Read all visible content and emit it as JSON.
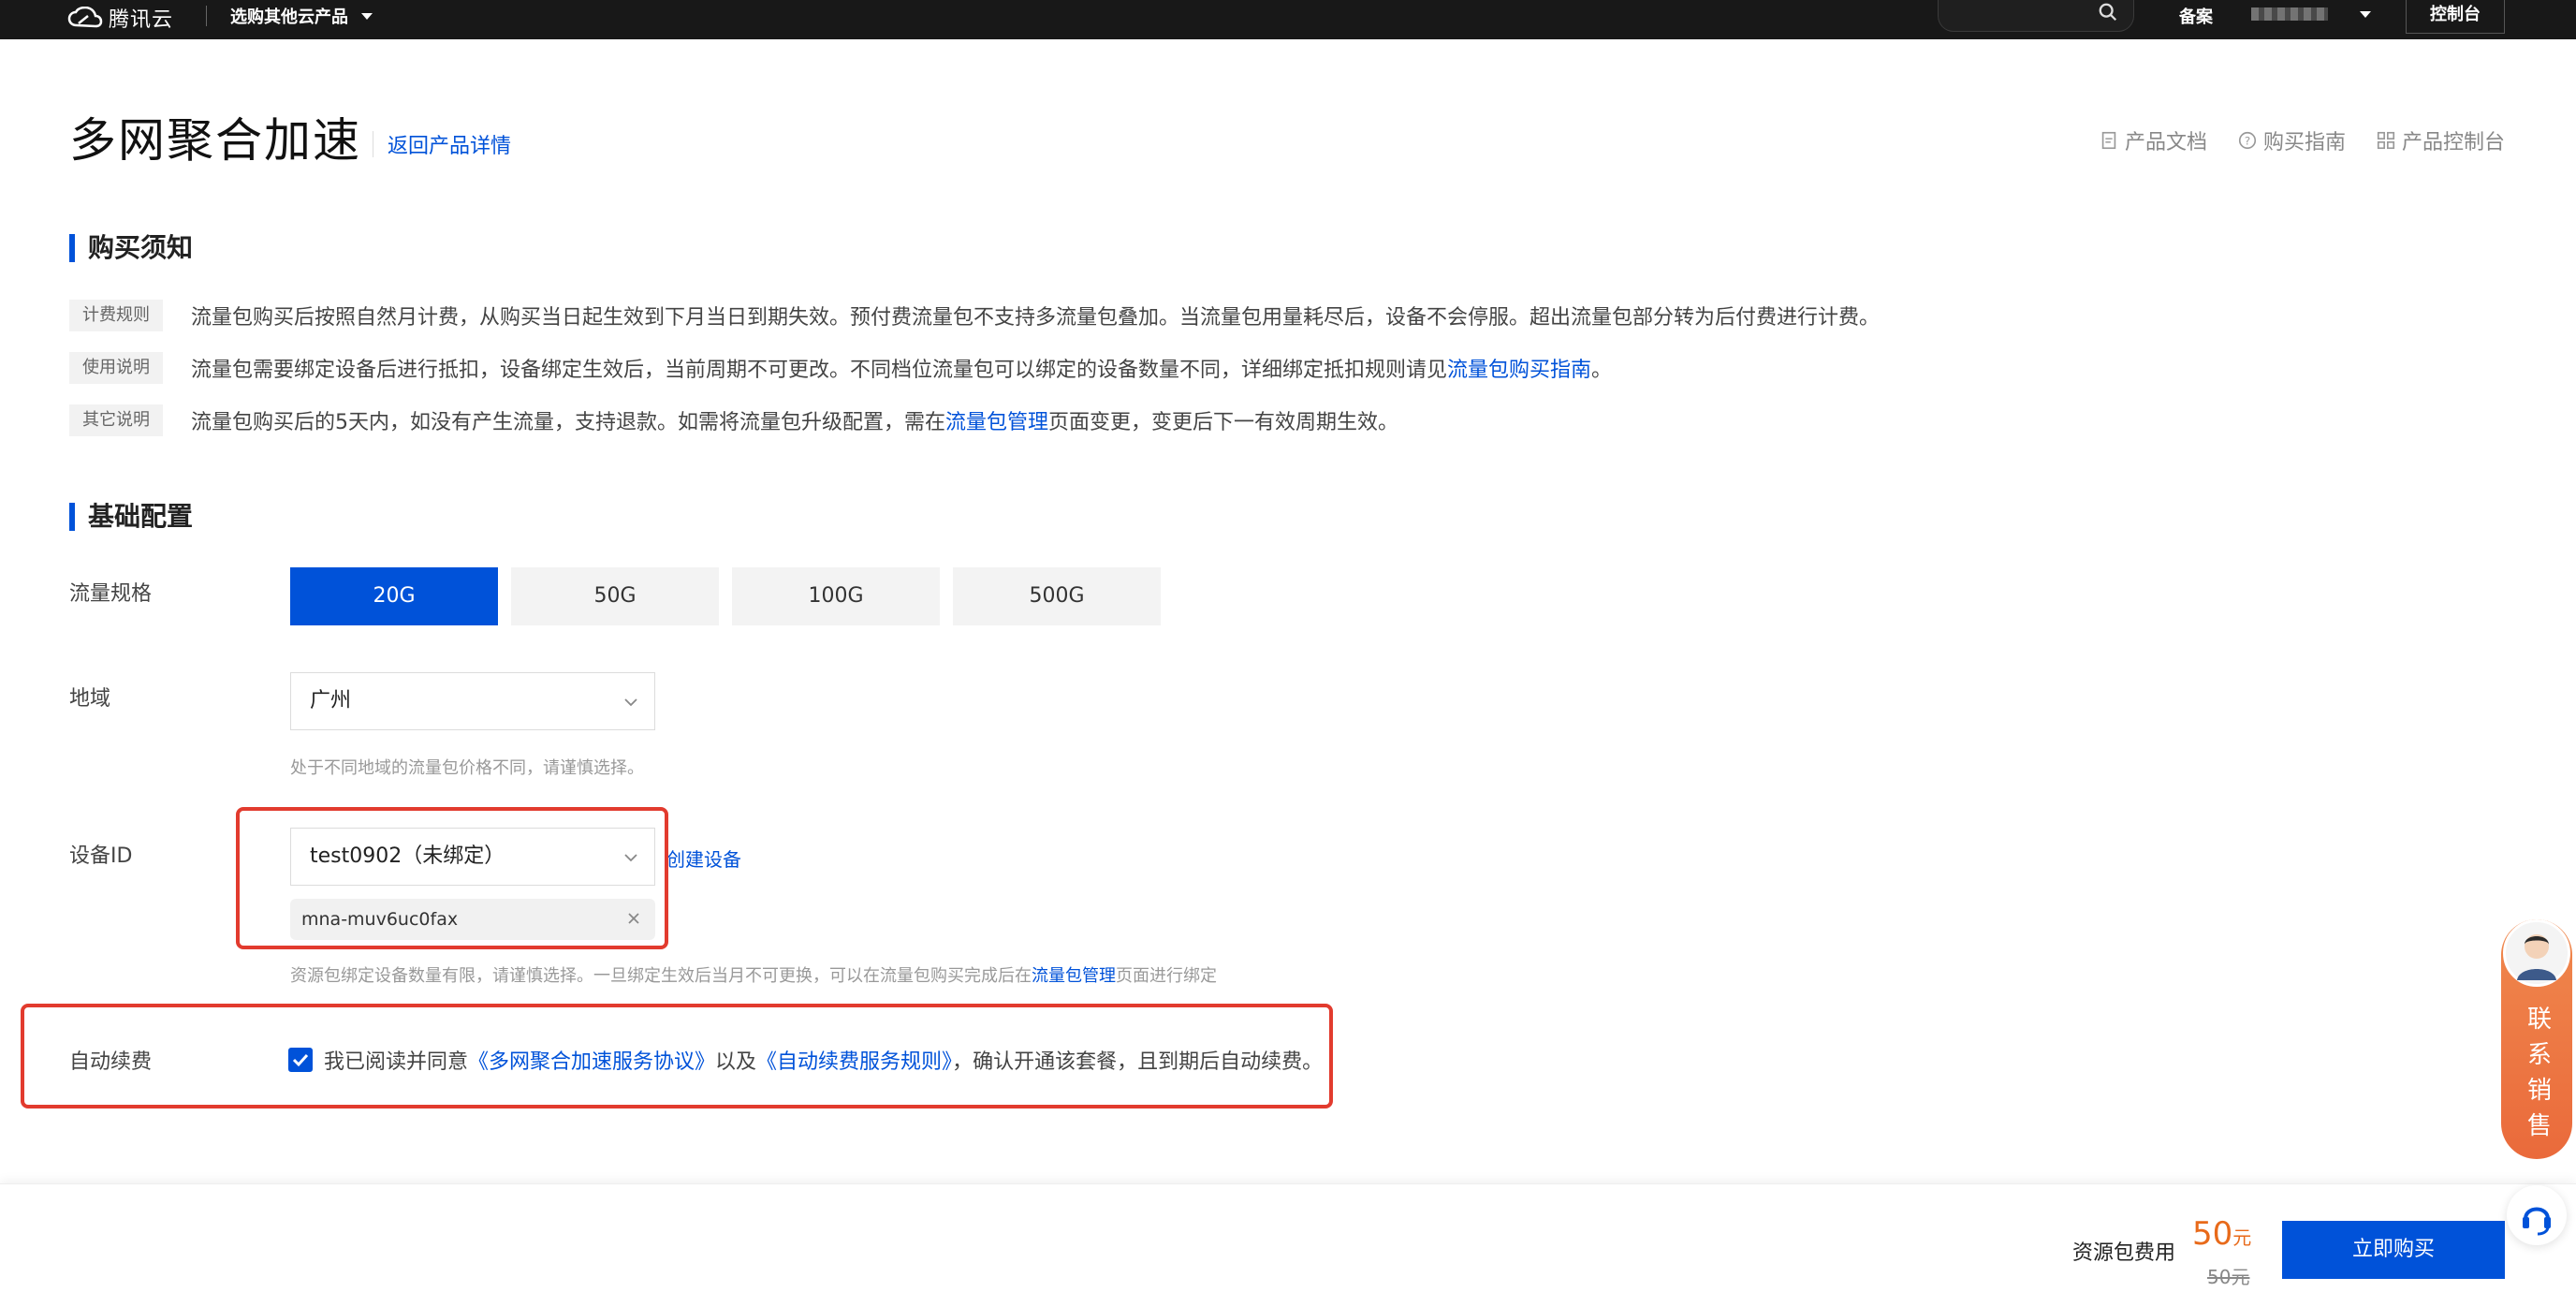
{
  "topbar": {
    "logo_text": "腾讯云",
    "other_products": "选购其他云产品",
    "search_placeholder": "",
    "beian": "备案",
    "console": "控制台"
  },
  "header": {
    "title": "多网聚合加速",
    "back_link": "返回产品详情",
    "links": [
      "产品文档",
      "购买指南",
      "产品控制台"
    ]
  },
  "notice": {
    "title": "购买须知",
    "rows": [
      {
        "tag": "计费规则",
        "text": "流量包购买后按照自然月计费，从购买当日起生效到下月当日到期失效。预付费流量包不支持多流量包叠加。当流量包用量耗尽后，设备不会停服。超出流量包部分转为后付费进行计费。"
      },
      {
        "tag": "使用说明",
        "text_before": "流量包需要绑定设备后进行抵扣，设备绑定生效后，当前周期不可更改。不同档位流量包可以绑定的设备数量不同，详细绑定抵扣规则请见",
        "link": "流量包购买指南",
        "text_after": "。"
      },
      {
        "tag": "其它说明",
        "text_before": "流量包购买后的5天内，如没有产生流量，支持退款。如需将流量包升级配置，需在",
        "link": "流量包管理",
        "text_after": "页面变更，变更后下一有效周期生效。"
      }
    ]
  },
  "config": {
    "title": "基础配置",
    "spec_label": "流量规格",
    "specs": [
      "20G",
      "50G",
      "100G",
      "500G"
    ],
    "selected_spec": "20G",
    "region_label": "地域",
    "region_value": "广州",
    "region_hint": "处于不同地域的流量包价格不同，请谨慎选择。",
    "device_label": "设备ID",
    "device_value": "test0902（未绑定）",
    "device_chip": "mna-muv6uc0fax",
    "create_device": "创建设备",
    "device_hint_before": "资源包绑定设备数量有限，请谨慎选择。一旦绑定生效后当月不可更换，可以在流量包购买完成后在",
    "device_hint_link": "流量包管理",
    "device_hint_after": "页面进行绑定",
    "renew_label": "自动续费",
    "agree_before": "我已阅读并同意",
    "agree_link1": "《多网聚合加速服务协议》",
    "agree_mid": "以及",
    "agree_link2": "《自动续费服务规则》",
    "agree_after": "，确认开通该套餐，且到期后自动续费。"
  },
  "footer": {
    "fee_label": "资源包费用",
    "price": "50",
    "price_unit": "元",
    "original_price": "50元",
    "buy": "立即购买"
  },
  "side": {
    "contact_sales": "联系销售"
  },
  "colors": {
    "primary": "#0052d9",
    "highlight": "#e23b2e",
    "price": "#e86a1a"
  }
}
